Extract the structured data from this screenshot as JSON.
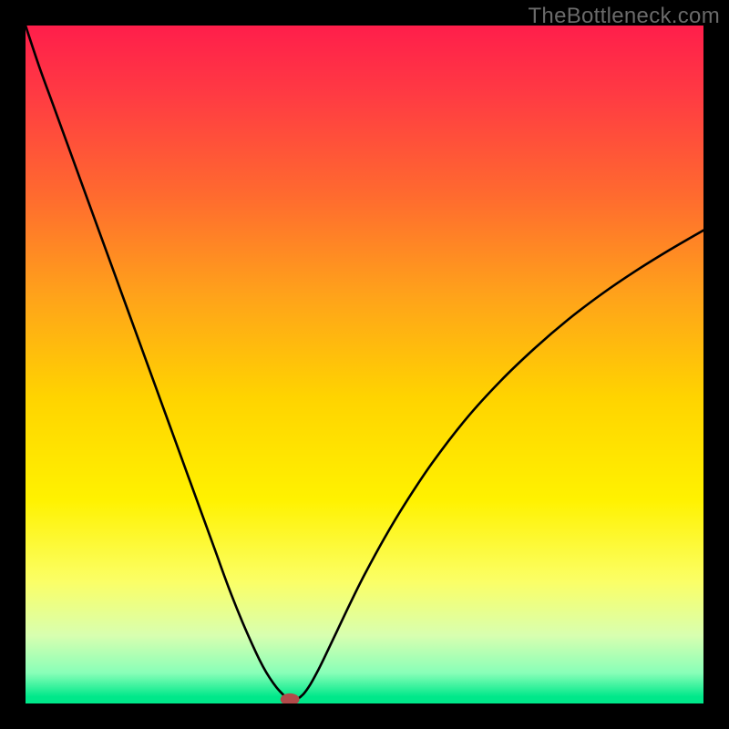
{
  "watermark": "TheBottleneck.com",
  "chart_data": {
    "type": "line",
    "title": "",
    "xlabel": "",
    "ylabel": "",
    "xlim": [
      0,
      100
    ],
    "ylim": [
      0,
      100
    ],
    "gradient_stops": [
      {
        "offset": 0.0,
        "color": "#ff1e4b"
      },
      {
        "offset": 0.1,
        "color": "#ff3a43"
      },
      {
        "offset": 0.25,
        "color": "#ff6a2f"
      },
      {
        "offset": 0.4,
        "color": "#ffa31a"
      },
      {
        "offset": 0.55,
        "color": "#ffd400"
      },
      {
        "offset": 0.7,
        "color": "#fff200"
      },
      {
        "offset": 0.82,
        "color": "#fbff66"
      },
      {
        "offset": 0.9,
        "color": "#d8ffb0"
      },
      {
        "offset": 0.955,
        "color": "#88ffb8"
      },
      {
        "offset": 0.99,
        "color": "#00e88a"
      },
      {
        "offset": 1.0,
        "color": "#00e88a"
      }
    ],
    "series": [
      {
        "name": "bottleneck-curve",
        "x": [
          0.0,
          2.0,
          4.0,
          6.0,
          8.0,
          10.0,
          12.0,
          14.0,
          16.0,
          18.0,
          20.0,
          22.0,
          24.0,
          26.0,
          28.0,
          30.0,
          32.0,
          34.0,
          35.0,
          36.0,
          37.0,
          38.0,
          38.7,
          39.3,
          40.0,
          41.0,
          42.0,
          43.0,
          44.0,
          46.0,
          48.0,
          50.0,
          53.0,
          56.0,
          60.0,
          65.0,
          70.0,
          75.0,
          80.0,
          85.0,
          90.0,
          95.0,
          100.0
        ],
        "y": [
          100.0,
          94.0,
          88.5,
          83.0,
          77.5,
          72.0,
          66.5,
          61.0,
          55.5,
          50.0,
          44.5,
          39.0,
          33.5,
          28.0,
          22.5,
          17.0,
          12.0,
          7.5,
          5.5,
          3.8,
          2.4,
          1.3,
          0.6,
          0.4,
          0.6,
          1.4,
          2.8,
          4.6,
          6.6,
          10.8,
          15.0,
          19.0,
          24.5,
          29.5,
          35.5,
          42.0,
          47.5,
          52.3,
          56.6,
          60.4,
          63.8,
          66.9,
          69.8
        ]
      }
    ],
    "marker": {
      "name": "optimal-point",
      "x": 39.0,
      "y": 0.6,
      "rx": 1.4,
      "ry": 0.9,
      "fill": "#b24a4a"
    }
  }
}
